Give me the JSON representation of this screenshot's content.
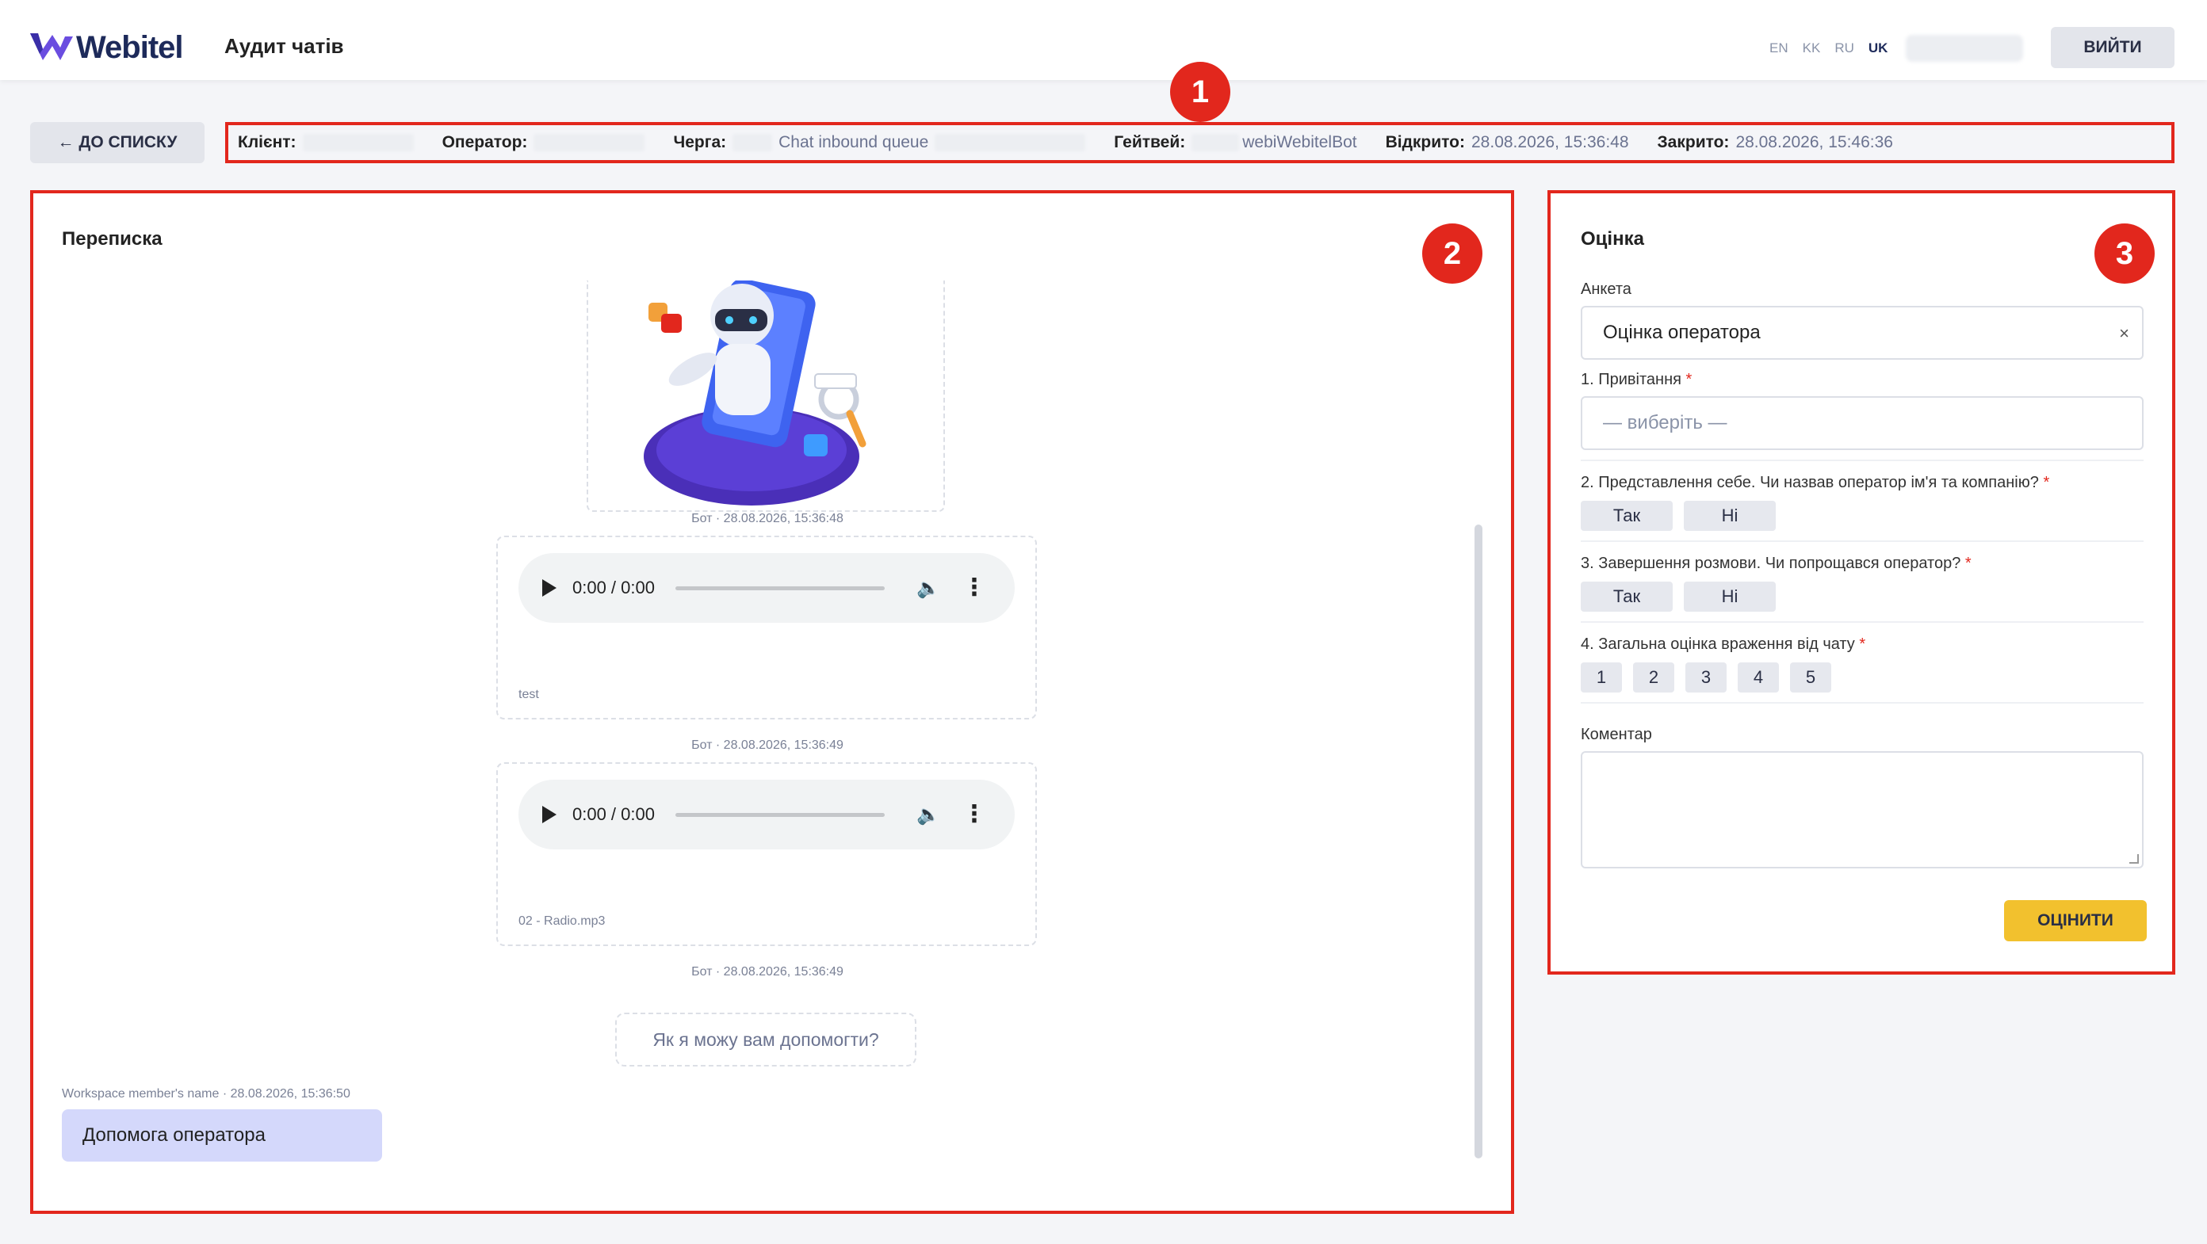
{
  "header": {
    "logo_text": "Webitel",
    "page_title": "Аудит чатів",
    "languages": [
      "EN",
      "KK",
      "RU",
      "UK"
    ],
    "active_language": "UK",
    "logout_label": "ВИЙТИ"
  },
  "back_button_label": "← ДО СПИСКУ",
  "info": {
    "client_label": "Клієнт:",
    "operator_label": "Оператор:",
    "queue_label": "Черга:",
    "queue_value": "Chat inbound queue",
    "gateway_label": "Гейтвей:",
    "gateway_value": "webiWebitelBot",
    "opened_label": "Відкрито:",
    "opened_value": "28.08.2026, 15:36:48",
    "closed_label": "Закрито:",
    "closed_value": "28.08.2026, 15:46:36"
  },
  "badges": {
    "one": "1",
    "two": "2",
    "three": "3"
  },
  "chat": {
    "title": "Переписка",
    "messages": [
      {
        "meta": "Бот · 28.08.2026, 15:36:48",
        "audio_time": "0:00 / 0:00",
        "file": "test"
      },
      {
        "meta": "Бот · 28.08.2026, 15:36:49",
        "audio_time": "0:00 / 0:00",
        "file": "02 - Radio.mp3"
      },
      {
        "meta": "Бот · 28.08.2026, 15:36:49",
        "text": "Як я можу вам допомогти?"
      }
    ],
    "operator_meta": "Workspace member's name · 28.08.2026, 15:36:50",
    "operator_text": "Допомога оператора"
  },
  "rating": {
    "title": "Оцінка",
    "form_label": "Анкета",
    "form_value": "Оцінка оператора",
    "clear_icon": "×",
    "q1_label": "1. Привітання",
    "q1_placeholder": "— виберіть —",
    "q2_label": "2. Представлення себе. Чи назвав оператор ім'я та компанію?",
    "q3_label": "3. Завершення розмови. Чи попрощався оператор?",
    "yes_label": "Так",
    "no_label": "Ні",
    "q4_label": "4. Загальна оцінка враження від чату",
    "scale": [
      "1",
      "2",
      "3",
      "4",
      "5"
    ],
    "required_mark": "*",
    "comment_label": "Коментар",
    "submit_label": "ОЦІНИТИ"
  },
  "colors": {
    "annotation_red": "#e2271d",
    "operator_bubble": "#d4d8fb",
    "submit_yellow": "#f2c12e",
    "brand_purple": "#5b3fd6"
  }
}
